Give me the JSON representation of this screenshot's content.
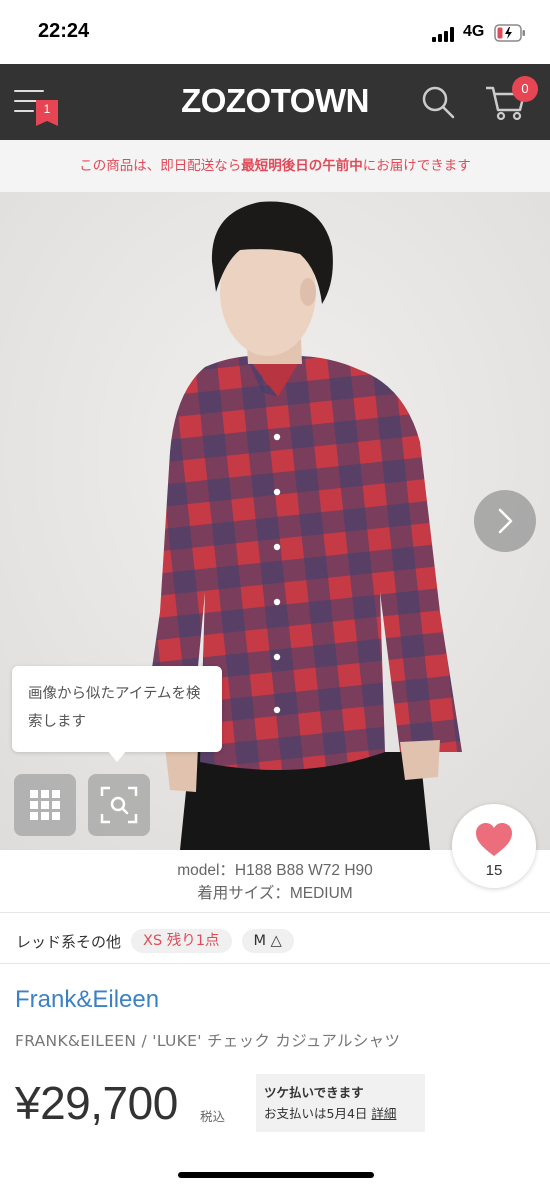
{
  "status_bar": {
    "time": "22:24",
    "network": "4G"
  },
  "header": {
    "logo": "ZOZOTOWN",
    "menu_badge": "1",
    "cart_badge": "0"
  },
  "delivery": {
    "prefix": "この商品は、即日配送なら",
    "highlight": "最短明後日の午前中",
    "suffix": "にお届けできます"
  },
  "photo": {
    "tooltip": "画像から似たアイテムを検索します",
    "favorite_count": "15"
  },
  "model_info": {
    "line1": "model：H188 B88 W72 H90",
    "line2": "着用サイズ：MEDIUM"
  },
  "variants": {
    "color": "レッド系その他",
    "sizes": [
      "XS 残り1点",
      "M △"
    ]
  },
  "product": {
    "brand": "Frank&Eileen",
    "name": "FRANK&EILEEN / 'LUKE' チェック カジュアルシャツ",
    "price": "¥29,700",
    "tax": "税込"
  },
  "payment": {
    "title": "ツケ払いできます",
    "detail": "お支払いは5月4日",
    "link": "詳細"
  },
  "colors": {
    "accent": "#e14b59",
    "brand_link": "#3b82c4",
    "header": "#333333"
  }
}
